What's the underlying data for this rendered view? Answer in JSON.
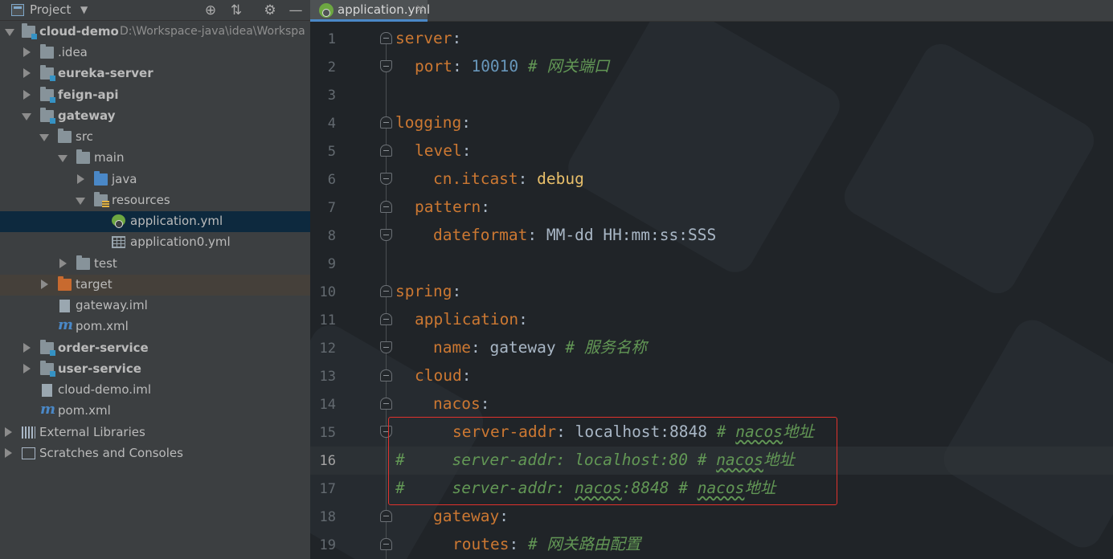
{
  "project_panel": {
    "title": "Project",
    "caret": "▼",
    "buttons": [
      "⊕",
      "⇅",
      "⚙",
      "—"
    ],
    "tree": [
      {
        "label": "cloud-demo",
        "path": "D:\\Workspace-java\\idea\\Workspa",
        "bold": true
      },
      {
        "label": ".idea",
        "bold": false
      },
      {
        "label": "eureka-server",
        "bold": true
      },
      {
        "label": "feign-api",
        "bold": true
      },
      {
        "label": "gateway",
        "bold": true
      },
      {
        "label": "src",
        "bold": false
      },
      {
        "label": "main",
        "bold": false
      },
      {
        "label": "java",
        "bold": false
      },
      {
        "label": "resources",
        "bold": false
      },
      {
        "label": "application.yml",
        "bold": false
      },
      {
        "label": "application0.yml",
        "bold": false
      },
      {
        "label": "test",
        "bold": false
      },
      {
        "label": "target",
        "bold": false
      },
      {
        "label": "gateway.iml",
        "bold": false
      },
      {
        "label": "pom.xml",
        "bold": false
      },
      {
        "label": "order-service",
        "bold": true
      },
      {
        "label": "user-service",
        "bold": true
      },
      {
        "label": "cloud-demo.iml",
        "bold": false
      },
      {
        "label": "pom.xml",
        "bold": false
      },
      {
        "label": "External Libraries",
        "bold": false
      },
      {
        "label": "Scratches and Consoles",
        "bold": false
      }
    ],
    "maven_glyph": "m"
  },
  "editor": {
    "tab": {
      "label": "application.yml",
      "close": "×"
    },
    "line_numbers": [
      "1",
      "2",
      "3",
      "4",
      "5",
      "6",
      "7",
      "8",
      "9",
      "10",
      "11",
      "12",
      "13",
      "14",
      "15",
      "16",
      "17",
      "18",
      "19"
    ],
    "current_line": "16",
    "lines": {
      "l1": {
        "key": "server",
        "colon": ":"
      },
      "l2": {
        "key": "port",
        "colon": ": ",
        "value": "10010",
        "comment": "# 网关端口"
      },
      "l4": {
        "key": "logging",
        "colon": ":"
      },
      "l5": {
        "key": "level",
        "colon": ":"
      },
      "l6": {
        "key": "cn.itcast",
        "colon": ": ",
        "value": "debug"
      },
      "l7": {
        "key": "pattern",
        "colon": ":"
      },
      "l8": {
        "key": "dateformat",
        "colon": ": ",
        "value": "MM-dd HH:mm:ss:SSS"
      },
      "l10": {
        "key": "spring",
        "colon": ":"
      },
      "l11": {
        "key": "application",
        "colon": ":"
      },
      "l12": {
        "key": "name",
        "colon": ": ",
        "value": "gateway",
        "comment": "# 服务名称"
      },
      "l13": {
        "key": "cloud",
        "colon": ":"
      },
      "l14": {
        "key": "nacos",
        "colon": ":"
      },
      "l15": {
        "key": "server-addr",
        "colon": ": ",
        "value": "localhost:8848",
        "comment_hash": "# ",
        "comment_word": "nacos",
        "comment_tail": "地址"
      },
      "l16": {
        "hash": "#",
        "pad": "     ",
        "text": "server-addr: localhost:80 # ",
        "word": "nacos",
        "tail": "地址"
      },
      "l17": {
        "hash": "#",
        "pad": "     ",
        "text_a": "server-addr: ",
        "word_a": "nacos",
        "text_b": ":8848 # ",
        "word_b": "nacos",
        "tail": "地址"
      },
      "l18": {
        "key": "gateway",
        "colon": ":"
      },
      "l19": {
        "key": "routes",
        "colon": ": ",
        "comment": "# 网关路由配置"
      }
    }
  },
  "colors": {
    "panel_bg": "#3c3f41",
    "editor_bg": "#202428",
    "keyword": "#cc7832",
    "number": "#6897bb",
    "comment": "#629755",
    "selection": "#0d293e",
    "highlight_box": "#e0322d"
  }
}
